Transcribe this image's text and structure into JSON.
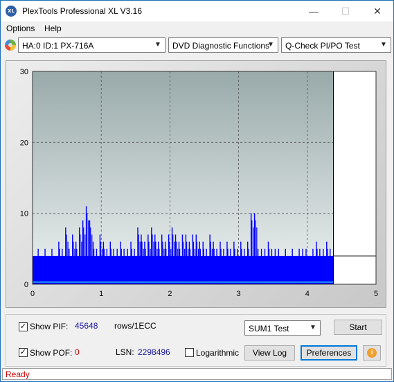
{
  "window": {
    "title": "PlexTools Professional XL V3.16",
    "app_icon_text": "XL",
    "minimize": "—",
    "maximize": "☐",
    "close": "✕"
  },
  "menu": {
    "items": [
      {
        "label": "Options"
      },
      {
        "label": "Help"
      }
    ]
  },
  "toolbar": {
    "drive": "HA:0 ID:1  PX-716A",
    "function": "DVD Diagnostic Functions",
    "test": "Q-Check PI/PO Test"
  },
  "chart_data": {
    "type": "bar",
    "y_ticks": [
      "30",
      "20",
      "10",
      "0"
    ],
    "x_ticks": [
      "0",
      "1",
      "2",
      "3",
      "4",
      "5"
    ],
    "xlim": [
      0,
      5
    ],
    "ylim": [
      0,
      30
    ],
    "grid": true,
    "end_marker_x": 4.38,
    "colors": {
      "plot_bg_top": "#99aaaa",
      "plot_bg_bottom": "#eef2f2",
      "bars": "#0000ff",
      "sum_line": "#1e90ff"
    },
    "series": [
      {
        "values_note_free": true,
        "typical_range": [
          3,
          4
        ],
        "x": [
          0.05,
          0.1,
          0.15,
          0.2,
          0.25,
          0.3,
          0.35,
          0.4,
          0.45,
          0.5,
          0.55,
          0.6,
          0.65,
          0.7,
          0.75,
          0.8,
          0.85,
          0.9,
          0.95,
          1.0,
          1.05,
          1.1,
          1.15,
          1.2,
          1.25,
          1.3,
          1.35,
          1.4,
          1.45,
          1.5,
          1.55,
          1.6,
          1.65,
          1.7,
          1.75,
          1.8,
          1.85,
          1.9,
          1.95,
          2.0,
          2.05,
          2.1,
          2.15,
          2.2,
          2.25,
          2.3,
          2.35,
          2.4,
          2.45,
          2.5,
          2.55,
          2.6,
          2.65,
          2.7,
          2.75,
          2.8,
          2.85,
          2.9,
          2.95,
          3.0,
          3.05,
          3.1,
          3.15,
          3.2,
          3.25,
          3.3,
          3.35,
          3.4,
          3.45,
          3.5,
          3.55,
          3.6,
          3.65,
          3.7,
          3.75,
          3.8,
          3.85,
          3.9,
          3.95,
          4.0,
          4.05,
          4.1,
          4.15,
          4.2,
          4.25,
          4.3,
          4.35
        ],
        "values": [
          4,
          5,
          4,
          5,
          4,
          5,
          4,
          6,
          5,
          8,
          5,
          7,
          6,
          8,
          9,
          11,
          9,
          6,
          5,
          7,
          6,
          5,
          6,
          5,
          5,
          6,
          5,
          5,
          6,
          5,
          8,
          7,
          6,
          7,
          8,
          7,
          6,
          7,
          6,
          7,
          8,
          7,
          6,
          7,
          7,
          6,
          7,
          7,
          6,
          6,
          5,
          7,
          6,
          5,
          6,
          5,
          6,
          5,
          6,
          5,
          6,
          5,
          6,
          10,
          10,
          5,
          5,
          5,
          6,
          5,
          5,
          5,
          4,
          5,
          4,
          5,
          4,
          5,
          5,
          5,
          4,
          5,
          6,
          5,
          5,
          6,
          5
        ]
      }
    ]
  },
  "bottom": {
    "show_pif_label": "Show PIF:",
    "show_pif_checked": "✓",
    "pif_value": "45648",
    "pif_unit": "rows/1ECC",
    "show_pof_label": "Show POF:",
    "show_pof_checked": "✓",
    "pof_value": "0",
    "lsn_label": "LSN:",
    "lsn_value": "2298496",
    "logarithmic_label": "Logarithmic",
    "sum_select": "SUM1 Test",
    "start_label": "Start",
    "view_log_label": "View Log",
    "preferences_label": "Preferences",
    "info_icon": "i"
  },
  "status": {
    "text": "Ready"
  }
}
